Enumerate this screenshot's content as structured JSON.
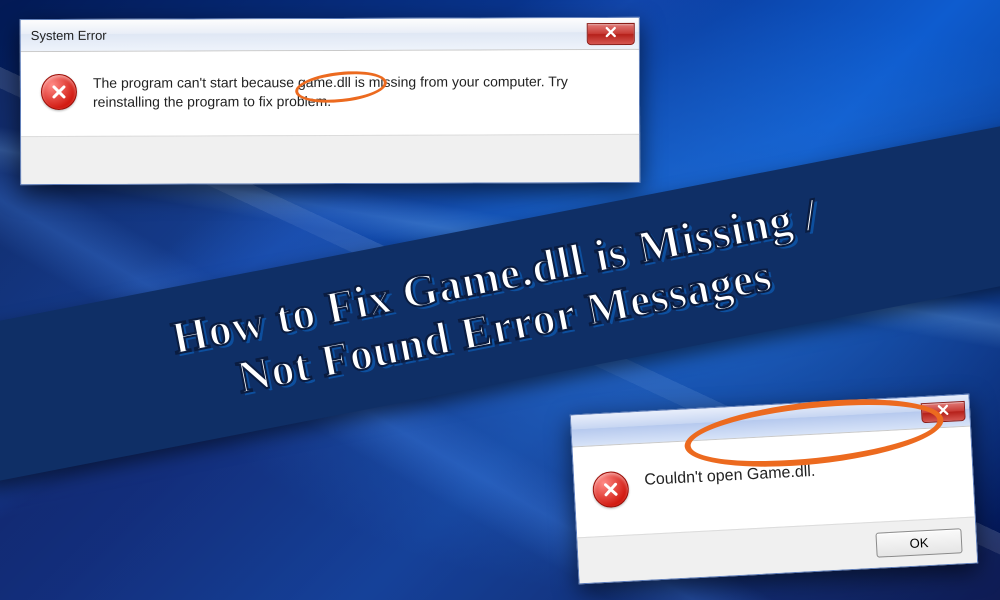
{
  "banner": {
    "line1": "How to Fix Game.dll is Missing /",
    "line2": "Not Found Error Messages"
  },
  "dialog1": {
    "title": "System Error",
    "message": "The program can't start because game.dll is missing from your computer. Try reinstalling the program to fix problem.",
    "highlighted_phrase": "game.dll is"
  },
  "dialog2": {
    "title": "",
    "message": "Couldn't open Game.dll.",
    "ok_label": "OK"
  },
  "colors": {
    "annotation": "#ec6a1f",
    "banner_bg": "#0f2f66"
  }
}
